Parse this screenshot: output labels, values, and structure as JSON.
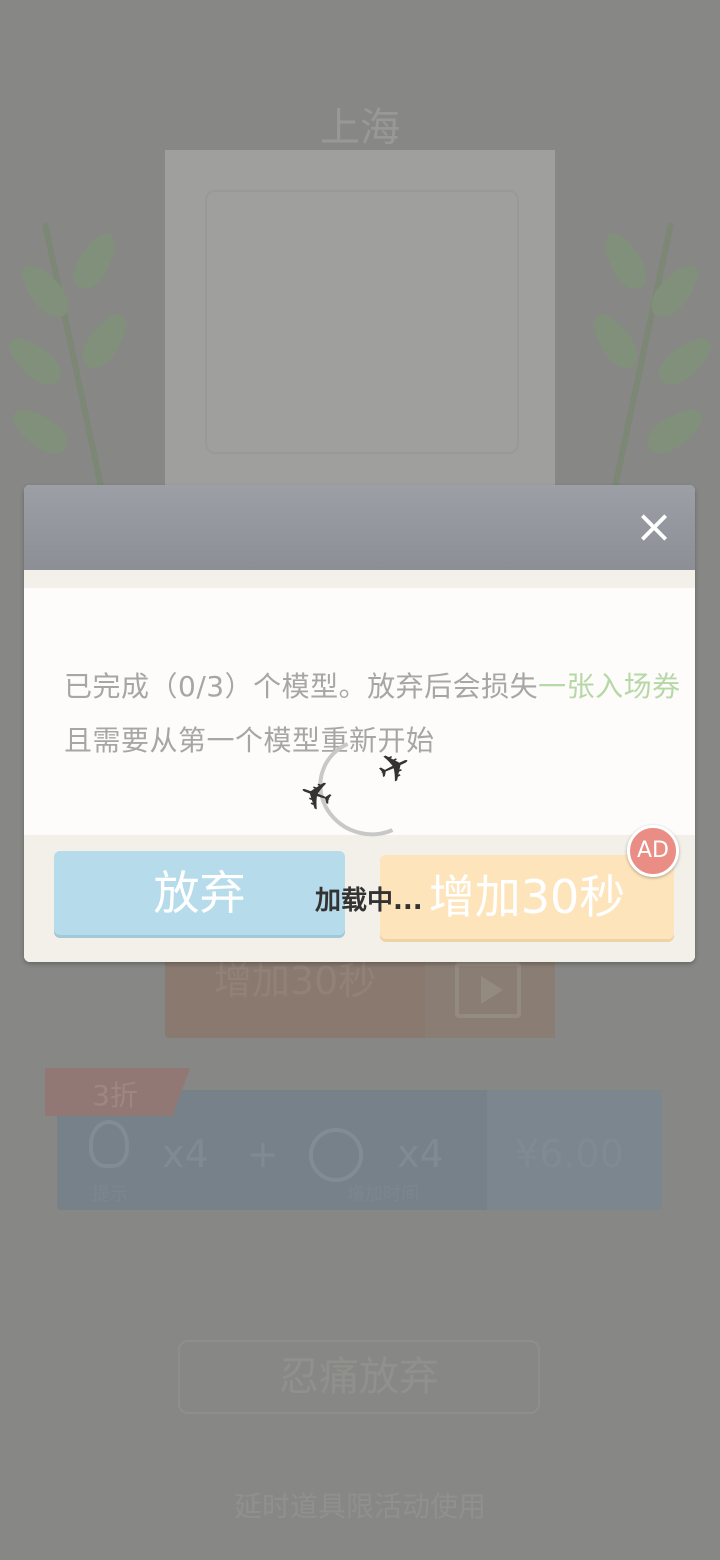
{
  "background": {
    "city_title": "上海",
    "add_time_label": "增加30秒",
    "discount_tag": "3折",
    "bundle": {
      "hint_count": "x4",
      "hint_label": "提示",
      "plus": "+",
      "time_count": "x4",
      "time_label": "增加时间",
      "price": "¥6.00"
    },
    "give_up_button": "忍痛放弃",
    "footer_note": "延时道具限活动使用"
  },
  "dialog": {
    "close_label": "×",
    "message_part1": "已完成（0/3）个模型。放弃后会损失",
    "message_highlight": "一张入场券",
    "message_part2": "且需要从第一个模型重新开始",
    "give_up_button": "放弃",
    "add_time_button": "增加30秒",
    "ad_badge": "AD"
  },
  "loading": {
    "text": "加载中..."
  },
  "colors": {
    "highlight_green": "#b6d8a6",
    "give_up_blue": "#b6dcec",
    "add_time_orange": "#fde4bb",
    "ad_red": "#e98d85"
  }
}
